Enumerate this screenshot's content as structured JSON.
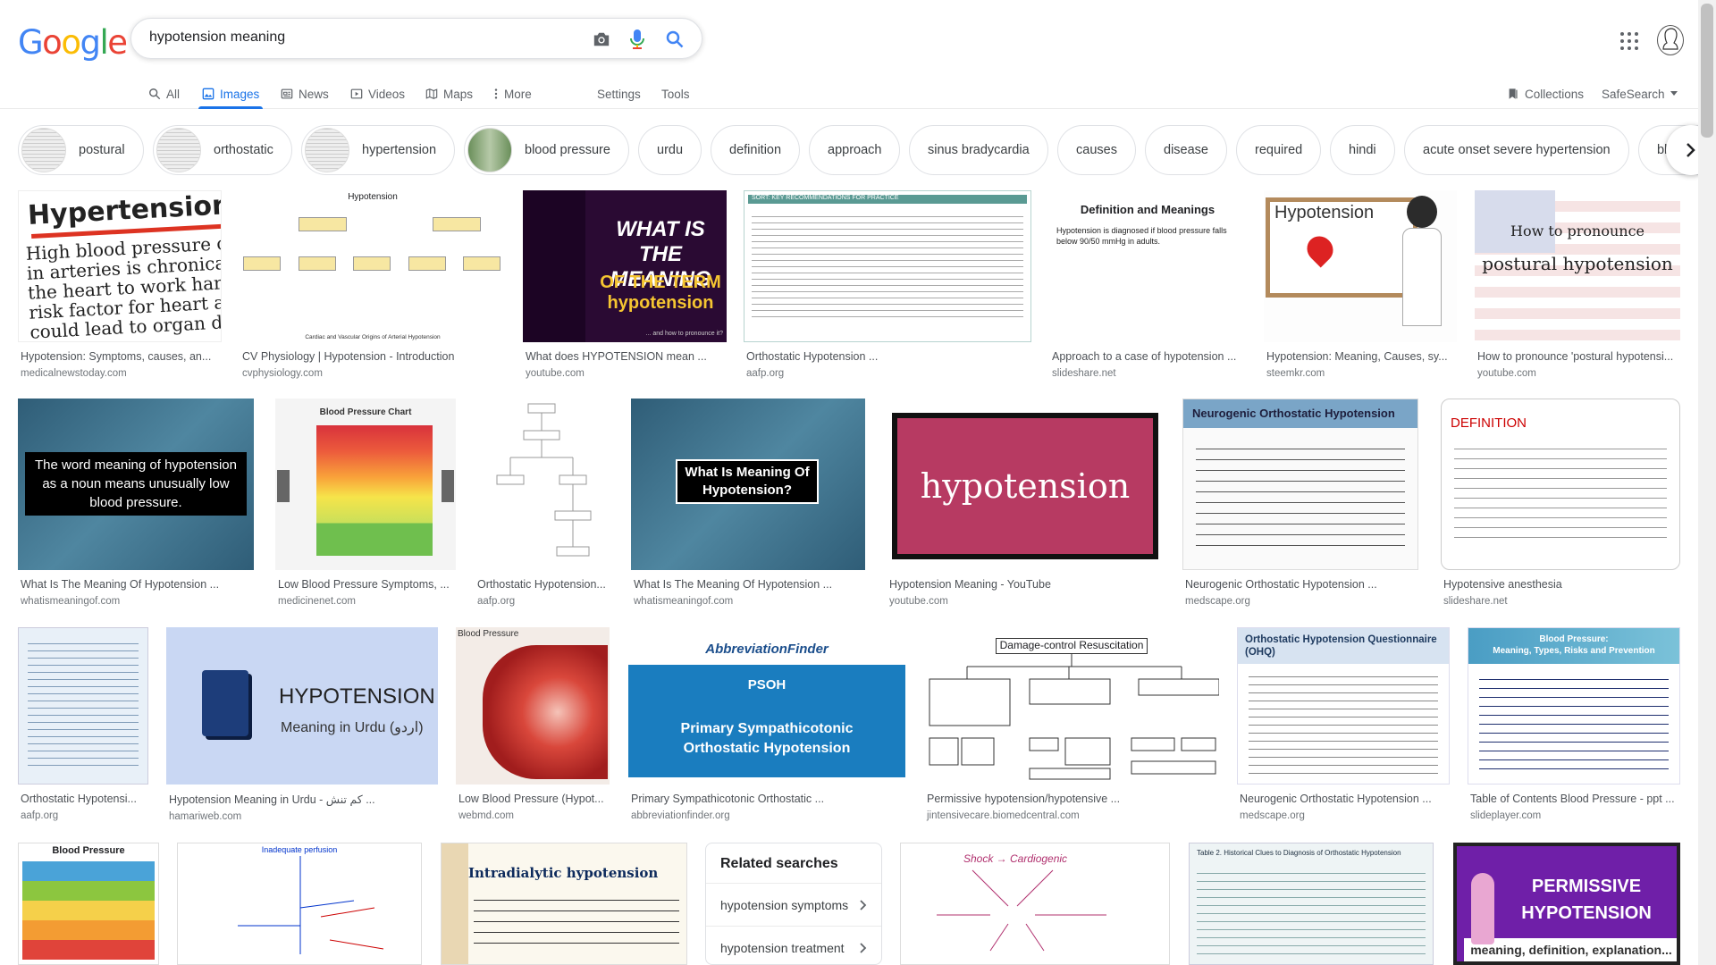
{
  "logo": {
    "letters": [
      "G",
      "o",
      "o",
      "g",
      "l",
      "e"
    ]
  },
  "search": {
    "query": "hypotension meaning"
  },
  "tabs": [
    {
      "label": "All",
      "icon": "search-icon"
    },
    {
      "label": "Images",
      "icon": "image-icon"
    },
    {
      "label": "News",
      "icon": "news-icon"
    },
    {
      "label": "Videos",
      "icon": "video-icon"
    },
    {
      "label": "Maps",
      "icon": "map-icon"
    },
    {
      "label": "More",
      "icon": "more-vert-icon"
    },
    {
      "label": "Settings"
    },
    {
      "label": "Tools"
    }
  ],
  "right_nav": {
    "collections": "Collections",
    "safesearch": "SafeSearch"
  },
  "chips": [
    "postural",
    "orthostatic",
    "hypertension",
    "blood pressure",
    "urdu",
    "definition",
    "approach",
    "sinus bradycardia",
    "causes",
    "disease",
    "required",
    "hindi",
    "acute onset severe hypertension",
    "blood loss"
  ],
  "results": [
    {
      "title": "Hypotension: Symptoms, causes, an...",
      "source": "medicalnewstoday.com",
      "img_text": "Hypertension",
      "img_sub": "High blood pressure or h in arteries is chronically the heart to work harde risk factor for heart att could lead to organ da"
    },
    {
      "title": "CV Physiology | Hypotension - Introduction",
      "source": "cvphysiology.com",
      "img_text": "Hypotension",
      "img_sub": "Cardiac and Vascular Origins of Arterial Hypotension"
    },
    {
      "title": "What does HYPOTENSION mean ...",
      "source": "youtube.com",
      "img_text": "WHAT IS THE MEANING",
      "img_sub": "OF THE TERM hypotension",
      "img_sub2": "... and how to pronounce it?"
    },
    {
      "title": "Orthostatic Hypotension ...",
      "source": "aafp.org",
      "img_text": "SORT: KEY RECOMMENDATIONS FOR PRACTICE"
    },
    {
      "title": "Approach to a case of hypotension ...",
      "source": "slideshare.net",
      "img_text": "Definition and Meanings",
      "img_sub": "Hypotension is diagnosed if blood pressure falls below 90/50 mmHg in adults."
    },
    {
      "title": "Hypotension: Meaning, Causes, sy...",
      "source": "steemkr.com",
      "img_text": "Hypotension"
    },
    {
      "title": "How to pronounce 'postural hypotensi...",
      "source": "youtube.com",
      "img_text": "How to pronounce",
      "img_sub": "postural hypotension"
    },
    {
      "title": "What Is The Meaning Of Hypotension ...",
      "source": "whatismeaningof.com",
      "img_text": "The word meaning of hypotension as a noun means unusually low blood pressure."
    },
    {
      "title": "Low Blood Pressure Symptoms, ...",
      "source": "medicinenet.com",
      "img_text": "Blood Pressure Chart"
    },
    {
      "title": "Orthostatic Hypotension...",
      "source": "aafp.org"
    },
    {
      "title": "What Is The Meaning Of Hypotension ...",
      "source": "whatismeaningof.com",
      "img_text": "What Is Meaning Of Hypotension?"
    },
    {
      "title": "Hypotension Meaning - YouTube",
      "source": "youtube.com",
      "img_text": "hypotension"
    },
    {
      "title": "Neurogenic Orthostatic Hypotension ...",
      "source": "medscape.org",
      "img_text": "Neurogenic Orthostatic Hypotension"
    },
    {
      "title": "Hypotensive anesthesia",
      "source": "slideshare.net",
      "img_text": "DEFINITION"
    },
    {
      "title": "Orthostatic Hypotensi...",
      "source": "aafp.org"
    },
    {
      "title": "Hypotension Meaning in Urdu - کم تنش ...",
      "source": "hamariweb.com",
      "img_text": "HYPOTENSION",
      "img_sub": "Meaning in Urdu (اردو)"
    },
    {
      "title": "Low Blood Pressure (Hypot...",
      "source": "webmd.com",
      "img_text": "Blood Pressure"
    },
    {
      "title": "Primary Sympathicotonic Orthostatic ...",
      "source": "abbreviationfinder.org",
      "img_text": "AbbreviationFinder",
      "img_sub": "PSOH",
      "img_sub2": "Primary Sympathicotonic Orthostatic Hypotension"
    },
    {
      "title": "Permissive hypotension/hypotensive ...",
      "source": "jintensivecare.biomedcentral.com",
      "img_text": "Damage-control Resuscitation"
    },
    {
      "title": "Neurogenic Orthostatic Hypotension ...",
      "source": "medscape.org",
      "img_text": "Orthostatic Hypotension Questionnaire (OHQ)"
    },
    {
      "title": "Table of Contents Blood Pressure - ppt ...",
      "source": "slideplayer.com",
      "img_text": "Blood Pressure:",
      "img_sub": "Meaning, Types, Risks and Prevention"
    }
  ],
  "row4": [
    {
      "img_text": "Blood Pressure"
    },
    {
      "img_text": "Inadequate perfusion"
    },
    {
      "img_text": "Intradialytic hypotension"
    },
    {
      "img_text": "Shock → Cardiogenic"
    },
    {
      "img_text": "Table 2. Historical Clues to Diagnosis of Orthostatic Hypotension"
    },
    {
      "img_text": "PERMISSIVE HYPOTENSION",
      "img_sub": "meaning, definition, explanation..."
    }
  ],
  "related": {
    "title": "Related searches",
    "items": [
      "hypotension symptoms",
      "hypotension treatment"
    ]
  },
  "colors": {
    "blue": "#1a73e8",
    "grey": "#5f6368"
  }
}
